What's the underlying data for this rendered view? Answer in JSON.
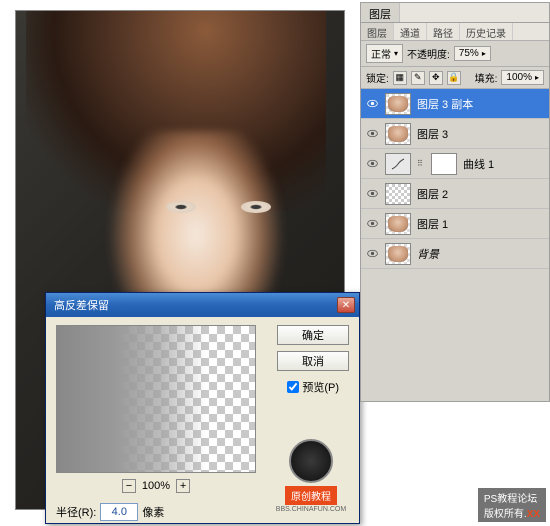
{
  "canvas": {
    "alt": "portrait-photo"
  },
  "dialog": {
    "title": "高反差保留",
    "ok": "确定",
    "cancel": "取消",
    "preview": "预览(P)",
    "zoom": {
      "minus": "−",
      "plus": "+",
      "amount": "100%"
    },
    "radius_label": "半径(R):",
    "radius_value": "4.0",
    "radius_unit": "像素",
    "watermark": {
      "tag": "原创教程",
      "sub": "BBS.CHINAFUN.COM"
    }
  },
  "layers": {
    "panel_tab": "图层",
    "subtabs": [
      "图层",
      "通道",
      "路径",
      "历史记录"
    ],
    "blend": "正常",
    "opacity_label": "不透明度:",
    "opacity_value": "75%",
    "lock_label": "锁定:",
    "fill_label": "填充:",
    "fill_value": "100%",
    "items": [
      {
        "name": "图层 3 副本",
        "selected": true,
        "kind": "face"
      },
      {
        "name": "图层 3",
        "kind": "face"
      },
      {
        "name": "曲线 1",
        "kind": "adjustment"
      },
      {
        "name": "图层 2",
        "kind": "trans"
      },
      {
        "name": "图层 1",
        "kind": "face"
      },
      {
        "name": "背景",
        "kind": "face",
        "italic": true
      }
    ]
  },
  "footer": {
    "left": "PS教程论坛",
    "right": "版权所有.",
    "xx": "XX"
  }
}
